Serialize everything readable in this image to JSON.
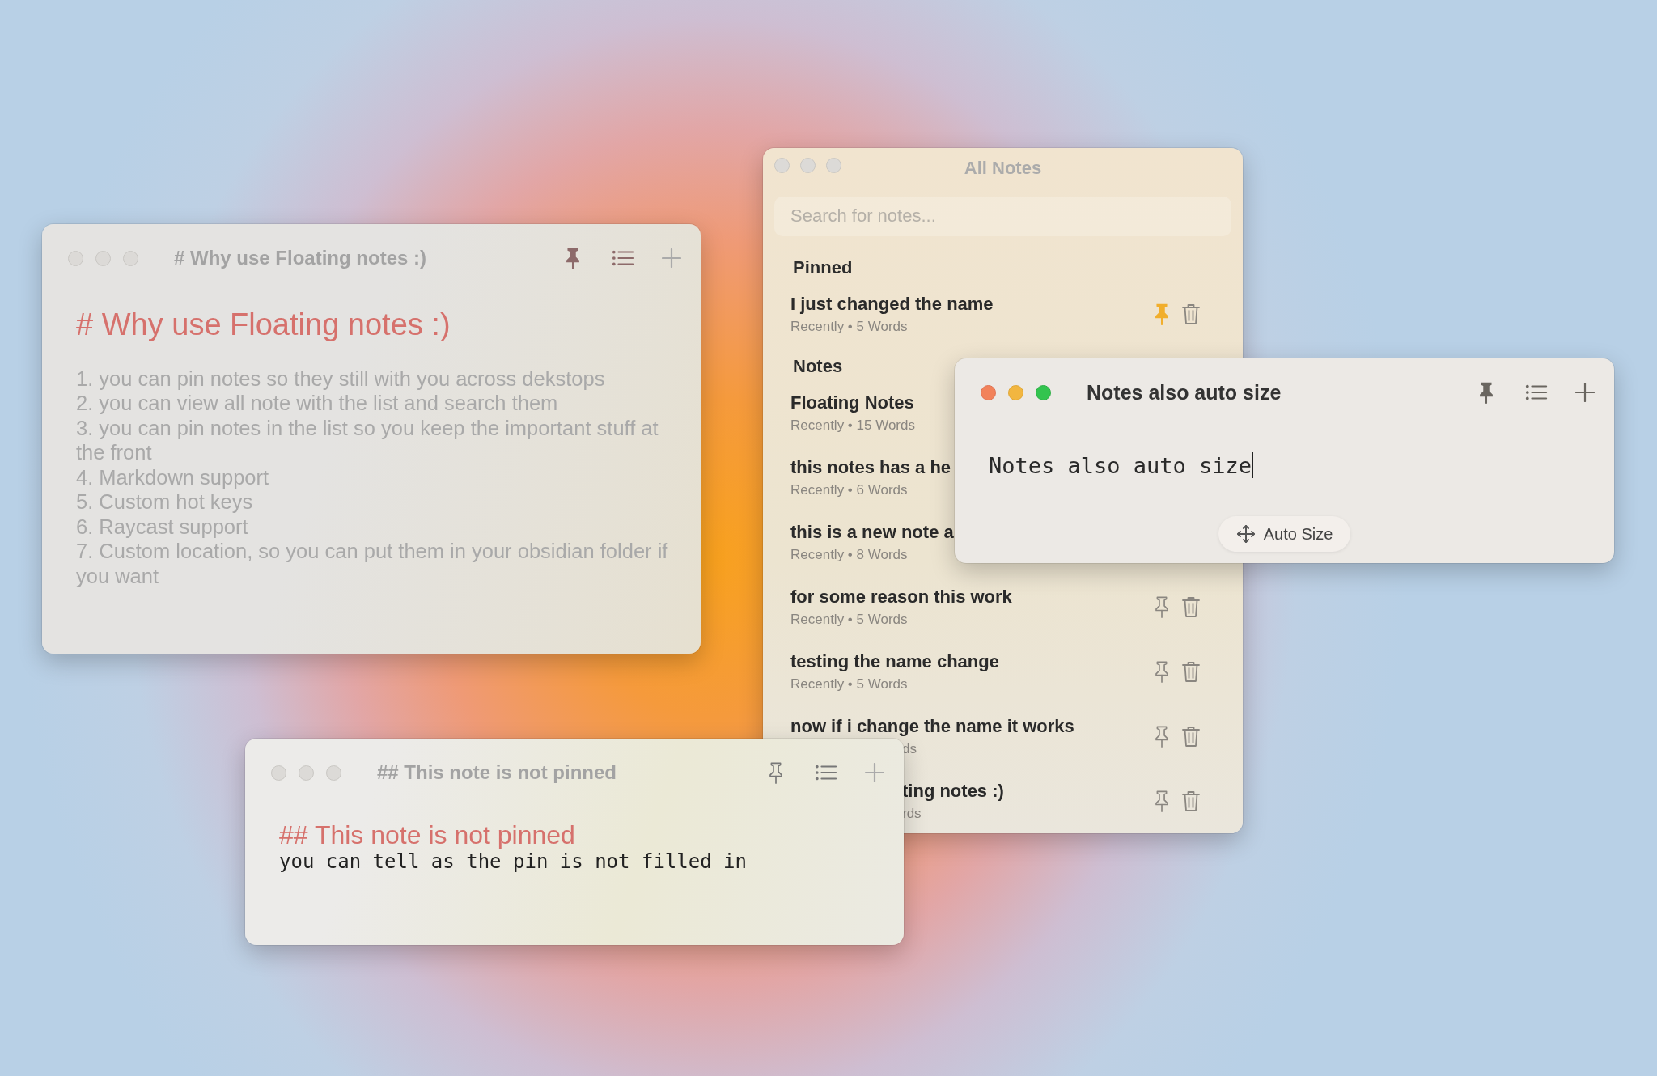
{
  "windows": [
    {
      "kind": "note",
      "title": "# Why use Floating notes :)",
      "active": false,
      "pinned": true,
      "blocks": [
        {
          "kind": "heading",
          "text": "# Why use Floating notes :)"
        },
        {
          "kind": "list_item",
          "text": "1. you can pin notes so they still with you across dekstops"
        },
        {
          "kind": "list_item",
          "text": "2. you can view all note with the list and search them"
        },
        {
          "kind": "list_item",
          "text": "3. you can pin notes in the list so you keep the important stuff at the front"
        },
        {
          "kind": "list_item",
          "text": "4. Markdown support"
        },
        {
          "kind": "list_item",
          "text": "5. Custom hot keys"
        },
        {
          "kind": "list_item",
          "text": "6. Raycast support"
        },
        {
          "kind": "list_item",
          "text": "7. Custom location, so you can put them in your obsidian folder if you want"
        }
      ]
    },
    {
      "kind": "list",
      "title": "All Notes",
      "active": false,
      "search": {
        "placeholder": "Search for notes..."
      },
      "sections": [
        {
          "label": "Pinned",
          "notes": [
            {
              "title": "I just changed the name",
              "meta": "Recently • 5 Words",
              "pinned": true
            }
          ]
        },
        {
          "label": "Notes",
          "notes": [
            {
              "title": "Floating Notes",
              "meta": "Recently • 15 Words"
            },
            {
              "title": "this notes has a he",
              "meta": "Recently • 6 Words"
            },
            {
              "title": "this is a new note a",
              "meta": "Recently • 8 Words"
            },
            {
              "title": "for some reason this work",
              "meta": "Recently • 5 Words",
              "pinned": false
            },
            {
              "title": "testing the name change",
              "meta": "Recently • 5 Words",
              "pinned": false
            },
            {
              "title": "now if i change the name it works",
              "meta": "ds",
              "pinned": false
            },
            {
              "title": "ting notes :)",
              "meta": "rds",
              "pinned": false
            }
          ]
        }
      ]
    },
    {
      "kind": "note",
      "title": "Notes also auto size",
      "active": true,
      "pinned": true,
      "caret": true,
      "blocks": [
        {
          "kind": "text",
          "text": "Notes also auto size"
        }
      ],
      "button": {
        "label": "Auto Size"
      }
    },
    {
      "kind": "note",
      "title": "## This note is not pinned",
      "active": false,
      "pinned": false,
      "blocks": [
        {
          "kind": "heading",
          "text": "## This note is not pinned"
        },
        {
          "kind": "text",
          "text": "you can tell as the pin is not filled in"
        }
      ]
    }
  ]
}
